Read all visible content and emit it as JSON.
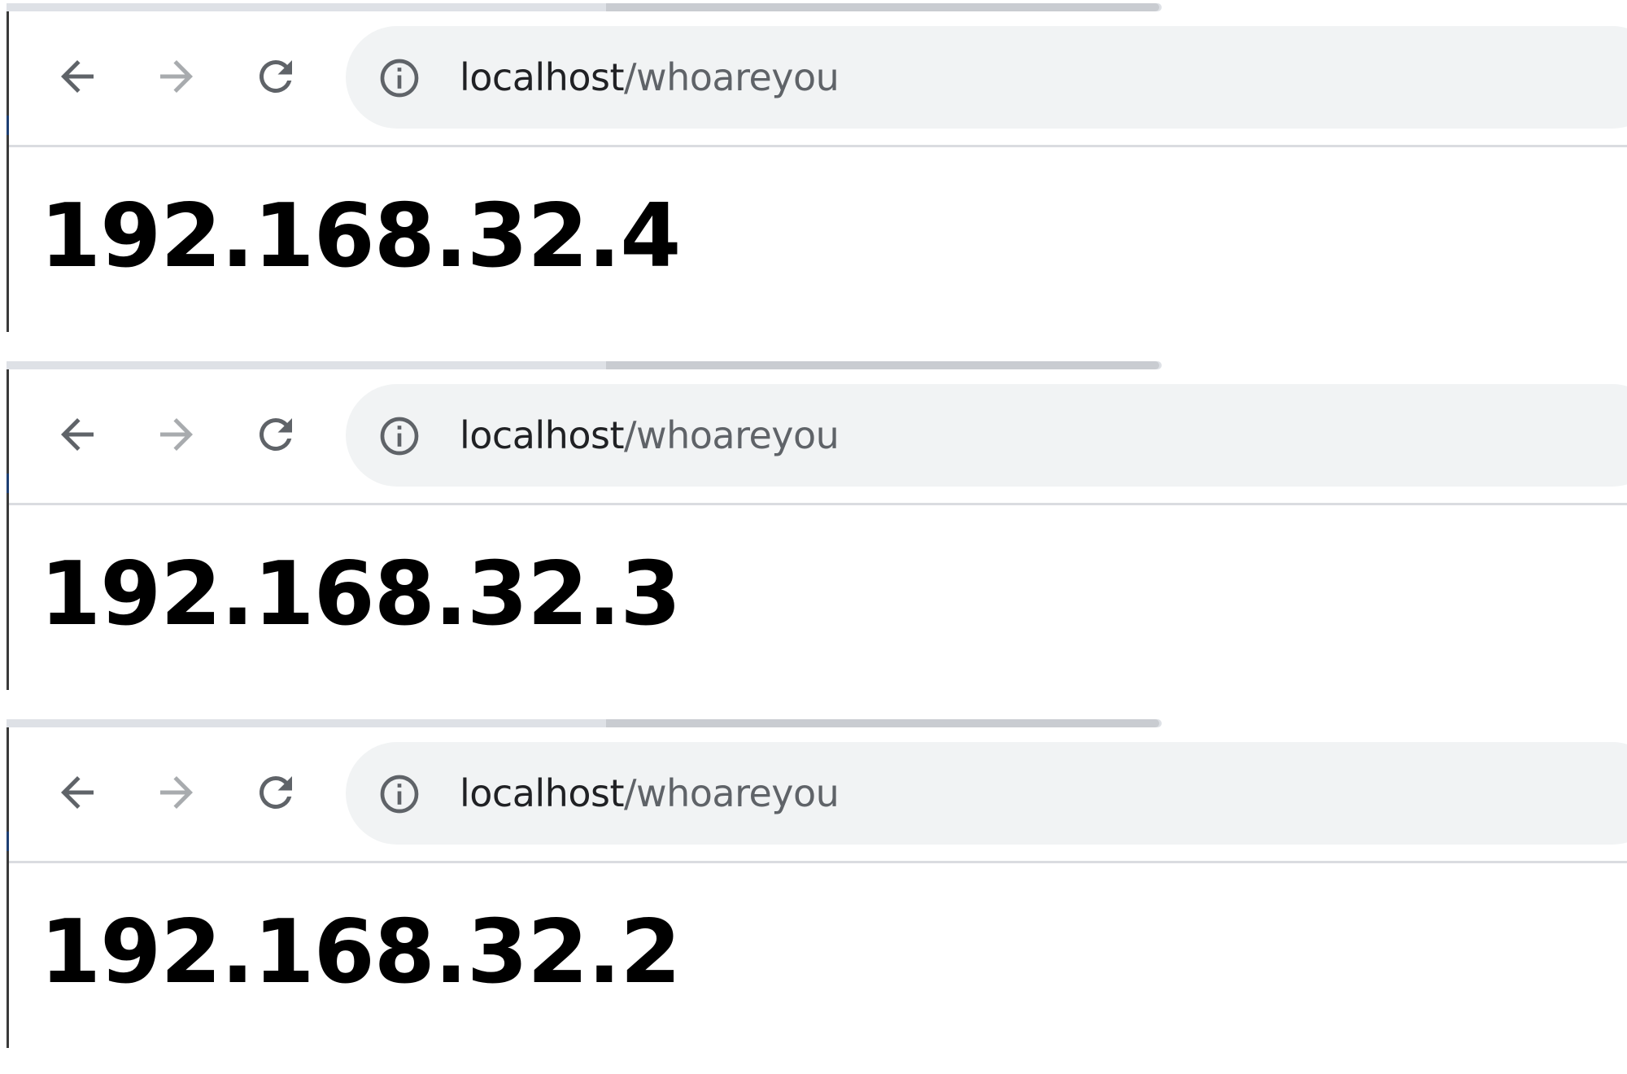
{
  "icons": {
    "back": "arrow-left-icon",
    "forward": "arrow-right-icon",
    "reload": "reload-icon",
    "info": "info-circle-icon"
  },
  "colors": {
    "omnibox_background": "#f1f3f4",
    "url_host": "#202124",
    "url_path": "#5f6368",
    "enabled_icon": "#5f6368",
    "disabled_icon": "#a8abae",
    "divider": "#dadce0"
  },
  "windows": [
    {
      "address": {
        "host": "localhost",
        "path": "/whoareyou"
      },
      "response": "192.168.32.4"
    },
    {
      "address": {
        "host": "localhost",
        "path": "/whoareyou"
      },
      "response": "192.168.32.3"
    },
    {
      "address": {
        "host": "localhost",
        "path": "/whoareyou"
      },
      "response": "192.168.32.2"
    }
  ]
}
